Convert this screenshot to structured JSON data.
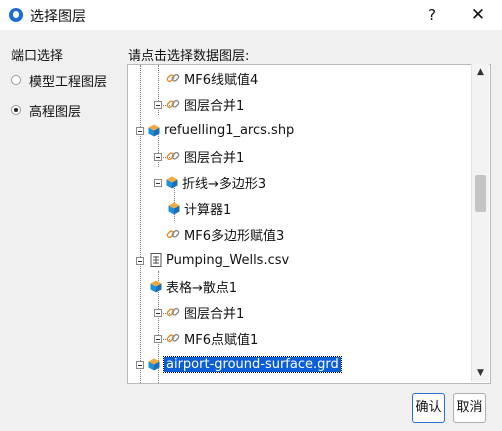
{
  "window": {
    "title": "选择图层",
    "help_label": "?",
    "close_label": "✕"
  },
  "port": {
    "label": "端口选择",
    "options": [
      {
        "label": "模型工程图层",
        "checked": false
      },
      {
        "label": "高程图层",
        "checked": true
      }
    ]
  },
  "tree": {
    "label": "请点击选择数据图层:",
    "items": [
      {
        "label": "MF6线赋值4",
        "icon": "link-icon"
      },
      {
        "label": "图层合并1",
        "icon": "link-icon"
      },
      {
        "label": "refuelling1_arcs.shp",
        "icon": "layer-cube-icon"
      },
      {
        "label": "图层合并1",
        "icon": "link-icon"
      },
      {
        "label": "折线→多边形3",
        "icon": "layer-cube-icon"
      },
      {
        "label": "计算器1",
        "icon": "layer-cube-icon"
      },
      {
        "label": "MF6多边形赋值3",
        "icon": "link-icon"
      },
      {
        "label": "Pumping_Wells.csv",
        "icon": "table-file-icon"
      },
      {
        "label": "表格→散点1",
        "icon": "layer-cube-icon"
      },
      {
        "label": "图层合并1",
        "icon": "link-icon"
      },
      {
        "label": "MF6点赋值1",
        "icon": "link-icon"
      },
      {
        "label": "airport-ground-surface.grd",
        "icon": "layer-cube-icon",
        "selected": true
      }
    ]
  },
  "scrollbar": {
    "up": "▲",
    "down": "▼"
  },
  "buttons": {
    "ok": "确认",
    "cancel": "取消"
  },
  "colors": {
    "selection": "#0b5ed7",
    "link_icon": "#e08a2c",
    "cube_top": "#f2a93b",
    "cube_side": "#1f8fd6"
  }
}
